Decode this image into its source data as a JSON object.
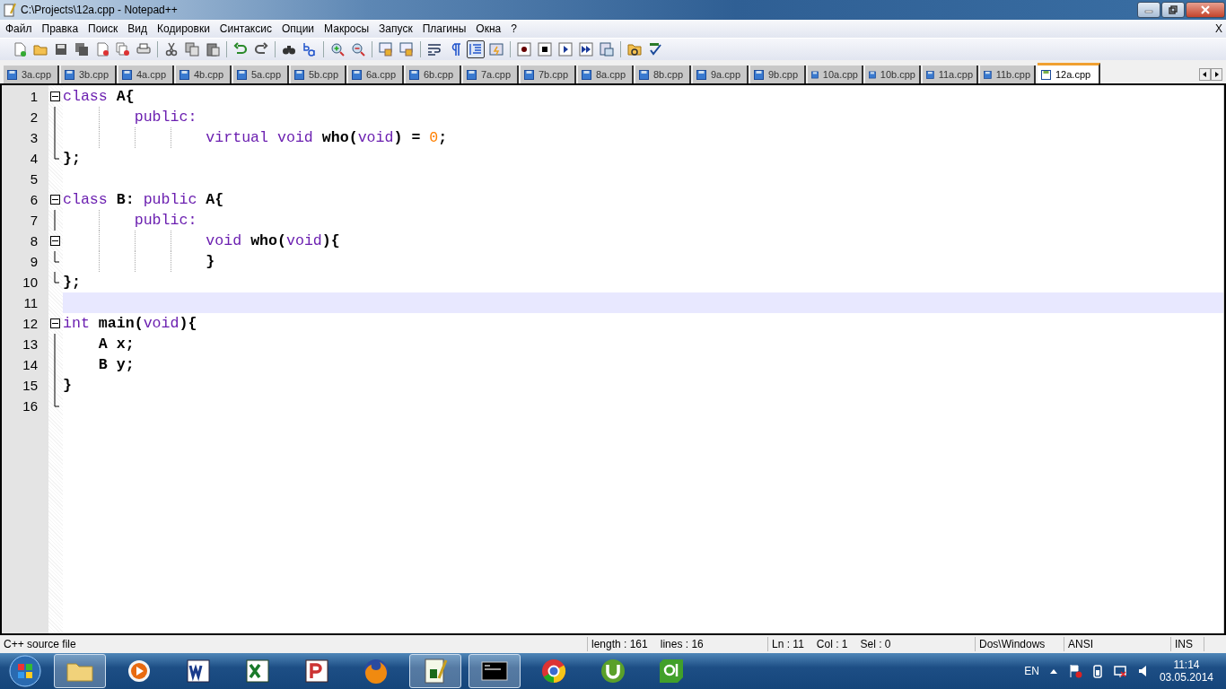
{
  "window": {
    "title": "C:\\Projects\\12a.cpp - Notepad++",
    "close_doc": "X"
  },
  "menu": [
    "Файл",
    "Правка",
    "Поиск",
    "Вид",
    "Кодировки",
    "Синтаксис",
    "Опции",
    "Макросы",
    "Запуск",
    "Плагины",
    "Окна",
    "?"
  ],
  "toolbar": [
    {
      "kind": "new",
      "pressed": false
    },
    {
      "kind": "open",
      "pressed": false
    },
    {
      "kind": "save",
      "pressed": false
    },
    {
      "kind": "saveall",
      "pressed": false
    },
    {
      "kind": "close",
      "pressed": false
    },
    {
      "kind": "closeall",
      "pressed": false
    },
    {
      "kind": "print",
      "pressed": false
    },
    {
      "kind": "sep"
    },
    {
      "kind": "cut",
      "pressed": false
    },
    {
      "kind": "copy",
      "pressed": false
    },
    {
      "kind": "paste",
      "pressed": false
    },
    {
      "kind": "sep"
    },
    {
      "kind": "undo",
      "pressed": false
    },
    {
      "kind": "redo",
      "pressed": false
    },
    {
      "kind": "sep"
    },
    {
      "kind": "find",
      "pressed": false
    },
    {
      "kind": "replace",
      "pressed": false
    },
    {
      "kind": "sep"
    },
    {
      "kind": "zoomin",
      "pressed": false
    },
    {
      "kind": "zoomout",
      "pressed": false
    },
    {
      "kind": "sep"
    },
    {
      "kind": "sync",
      "pressed": false
    },
    {
      "kind": "sync",
      "pressed": false
    },
    {
      "kind": "sep"
    },
    {
      "kind": "wrap",
      "pressed": false
    },
    {
      "kind": "pilcrow",
      "pressed": false
    },
    {
      "kind": "indent",
      "pressed": true
    },
    {
      "kind": "panel",
      "pressed": false
    },
    {
      "kind": "sep"
    },
    {
      "kind": "record",
      "pressed": false
    },
    {
      "kind": "stop",
      "pressed": false
    },
    {
      "kind": "play",
      "pressed": false
    },
    {
      "kind": "playmulti",
      "pressed": false
    },
    {
      "kind": "savemacro",
      "pressed": false
    },
    {
      "kind": "sep"
    },
    {
      "kind": "folder",
      "pressed": false
    },
    {
      "kind": "spell",
      "pressed": false
    }
  ],
  "tabs": [
    {
      "label": "3a.cpp",
      "selected": false
    },
    {
      "label": "3b.cpp",
      "selected": false
    },
    {
      "label": "4a.cpp",
      "selected": false
    },
    {
      "label": "4b.cpp",
      "selected": false
    },
    {
      "label": "5a.cpp",
      "selected": false
    },
    {
      "label": "5b.cpp",
      "selected": false
    },
    {
      "label": "6a.cpp",
      "selected": false
    },
    {
      "label": "6b.cpp",
      "selected": false
    },
    {
      "label": "7a.cpp",
      "selected": false
    },
    {
      "label": "7b.cpp",
      "selected": false
    },
    {
      "label": "8a.cpp",
      "selected": false
    },
    {
      "label": "8b.cpp",
      "selected": false
    },
    {
      "label": "9a.cpp",
      "selected": false
    },
    {
      "label": "9b.cpp",
      "selected": false
    },
    {
      "label": "10a.cpp",
      "selected": false
    },
    {
      "label": "10b.cpp",
      "selected": false
    },
    {
      "label": "11a.cpp",
      "selected": false
    },
    {
      "label": "11b.cpp",
      "selected": false
    },
    {
      "label": "12a.cpp",
      "selected": true
    }
  ],
  "editor": {
    "lines": [
      {
        "number": "1",
        "kind": "fold_start",
        "current": false,
        "tokens": [
          {
            "kind": "keyword",
            "text": "class"
          },
          {
            "kind": "plain",
            "text": " A{"
          }
        ]
      },
      {
        "number": "2",
        "kind": "fold_body",
        "current": false,
        "tokens": [
          {
            "kind": "keyword",
            "text": "\t\tpublic:"
          }
        ]
      },
      {
        "number": "3",
        "kind": "fold_body",
        "current": false,
        "tokens": [
          {
            "kind": "keyword",
            "text": "\t\t\t\tvirtual void"
          },
          {
            "kind": "plain",
            "text": " who("
          },
          {
            "kind": "keyword",
            "text": "void"
          },
          {
            "kind": "plain",
            "text": ") = "
          },
          {
            "kind": "number",
            "text": "0"
          },
          {
            "kind": "plain",
            "text": ";"
          }
        ]
      },
      {
        "number": "4",
        "kind": "fold_end",
        "current": false,
        "tokens": [
          {
            "kind": "plain",
            "text": "};"
          }
        ]
      },
      {
        "number": "5",
        "kind": "plain",
        "current": false
      },
      {
        "number": "6",
        "kind": "fold_start",
        "current": false,
        "tokens": [
          {
            "kind": "keyword",
            "text": "class"
          },
          {
            "kind": "plain",
            "text": " B: "
          },
          {
            "kind": "keyword",
            "text": "public"
          },
          {
            "kind": "plain",
            "text": " A{"
          }
        ]
      },
      {
        "number": "7",
        "kind": "fold_body",
        "current": false,
        "tokens": [
          {
            "kind": "keyword",
            "text": "\t\tpublic:"
          }
        ]
      },
      {
        "number": "8",
        "kind": "fold_start",
        "current": false,
        "tokens": [
          {
            "kind": "keyword",
            "text": "\t\t\t\tvoid"
          },
          {
            "kind": "plain",
            "text": " who("
          },
          {
            "kind": "keyword",
            "text": "void"
          },
          {
            "kind": "plain",
            "text": "){"
          }
        ]
      },
      {
        "number": "9",
        "kind": "fold_end",
        "current": false,
        "tokens": [
          {
            "kind": "plain",
            "text": "\t\t\t\t}"
          }
        ]
      },
      {
        "number": "10",
        "kind": "fold_end",
        "current": false,
        "tokens": [
          {
            "kind": "plain",
            "text": "};"
          }
        ]
      },
      {
        "number": "11",
        "kind": "plain",
        "current": true
      },
      {
        "number": "12",
        "kind": "fold_start",
        "current": false,
        "tokens": [
          {
            "kind": "keyword",
            "text": "int"
          },
          {
            "kind": "plain",
            "text": " main("
          },
          {
            "kind": "keyword",
            "text": "void"
          },
          {
            "kind": "plain",
            "text": "){"
          }
        ]
      },
      {
        "number": "13",
        "kind": "fold_body",
        "current": false,
        "tokens": [
          {
            "kind": "plain",
            "text": "\tA x;"
          }
        ]
      },
      {
        "number": "14",
        "kind": "fold_body",
        "current": false,
        "tokens": [
          {
            "kind": "plain",
            "text": "\tB y;"
          }
        ]
      },
      {
        "number": "15",
        "kind": "fold_body",
        "current": false,
        "tokens": [
          {
            "kind": "plain",
            "text": "}"
          }
        ]
      },
      {
        "number": "16",
        "kind": "fold_end",
        "current": false
      }
    ]
  },
  "status_bar": {
    "file_type": "C++ source file",
    "length": "length : 161",
    "lines": "lines : 16",
    "ln": "Ln : 11",
    "col": "Col : 1",
    "sel": "Sel : 0",
    "eol": "Dos\\Windows",
    "encoding": "ANSI",
    "mode": "INS"
  },
  "taskbar": {
    "apps": [
      {
        "kind": "explorer",
        "active": true
      },
      {
        "kind": "media",
        "active": false
      },
      {
        "kind": "word",
        "active": false
      },
      {
        "kind": "excel",
        "active": false
      },
      {
        "kind": "powerpoint",
        "active": false
      },
      {
        "kind": "firefox",
        "active": false
      },
      {
        "kind": "notepad",
        "active": true
      },
      {
        "kind": "console",
        "active": true
      },
      {
        "kind": "chrome",
        "active": false
      },
      {
        "kind": "torrent",
        "active": false
      },
      {
        "kind": "qt",
        "active": false
      }
    ],
    "language": "EN",
    "time": "11:14",
    "date": "03.05.2014"
  }
}
